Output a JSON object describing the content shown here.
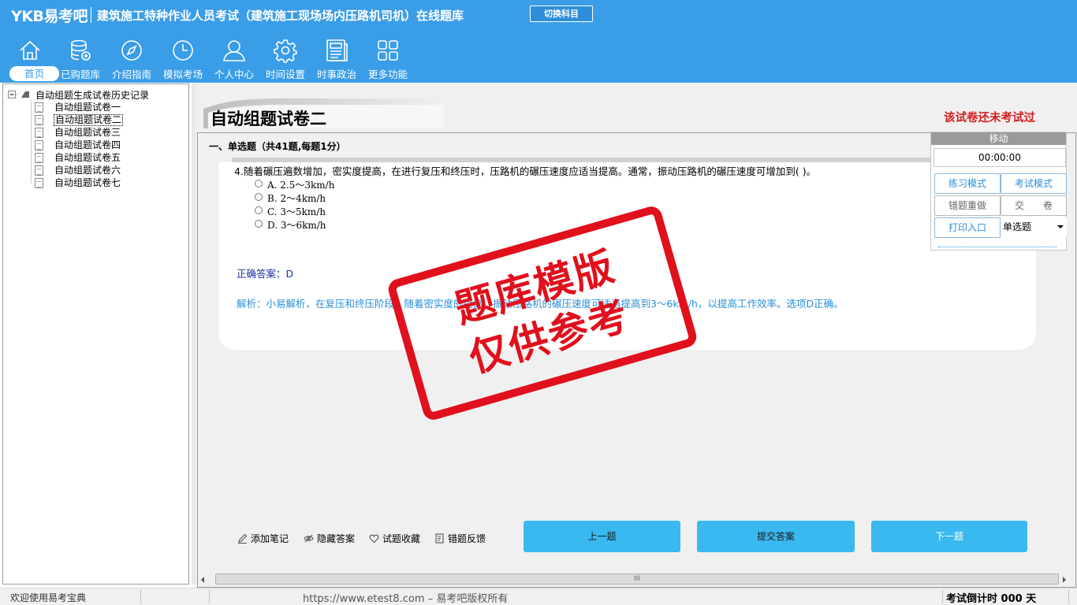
{
  "header": {
    "logo": "YKB易考吧",
    "title": "建筑施工特种作业人员考试（建筑施工现场场内压路机司机）在线题库",
    "switch_subject": "切换科目"
  },
  "nav": [
    {
      "label": "首页",
      "icon": "home-icon"
    },
    {
      "label": "已购题库",
      "icon": "database-icon"
    },
    {
      "label": "介绍指南",
      "icon": "compass-icon"
    },
    {
      "label": "模拟考场",
      "icon": "clock-icon"
    },
    {
      "label": "个人中心",
      "icon": "user-icon"
    },
    {
      "label": "时间设置",
      "icon": "gear-icon"
    },
    {
      "label": "时事政治",
      "icon": "newspaper-icon"
    },
    {
      "label": "更多功能",
      "icon": "grid-icon"
    }
  ],
  "tree": {
    "root": "自动组题生成试卷历史记录",
    "items": [
      "自动组题试卷一",
      "自动组题试卷二",
      "自动组题试卷三",
      "自动组题试卷四",
      "自动组题试卷五",
      "自动组题试卷六",
      "自动组题试卷七"
    ],
    "selected_index": 1
  },
  "paper": {
    "title": "自动组题试卷二",
    "status": "该试卷还未考试过",
    "section": "一、单选题（共41题,每题1分）"
  },
  "question": {
    "text": "4.随着碾压遍数增加，密实度提高，在进行复压和终压时，压路机的碾压速度应适当提高。通常，振动压路机的碾压速度可增加到(  )。",
    "options": [
      "A. 2.5～3km/h",
      "B. 2～4km/h",
      "C. 3～5km/h",
      "D. 3～6km/h"
    ],
    "answer": "正确答案：D",
    "analysis": "解析：小易解析，在复压和终压阶段，随着密实度的提高，振动压路机的碾压速度可适当提高到3～6km/h，以提高工作效率。选项D正确。"
  },
  "stamp": {
    "line1": "题库模版",
    "line2": "仅供参考"
  },
  "float_panel": {
    "move": "移动",
    "timer": "00:00:00",
    "practice_mode": "练习模式",
    "exam_mode": "考试模式",
    "redo_wrong": "错题重做",
    "submit_paper": "交　　卷",
    "print_entry": "打印入口",
    "question_type": "单选题"
  },
  "tools": {
    "add_note": "添加笔记",
    "hide_answer": "隐藏答案",
    "favorite": "试题收藏",
    "feedback": "错题反馈"
  },
  "buttons": {
    "prev": "上一题",
    "submit": "提交答案",
    "next": "下一题"
  },
  "scrollbar": {
    "thumb_grip": "III"
  },
  "statusbar": {
    "welcome": "欢迎使用易考宝典",
    "url": "https://www.etest8.com – 易考吧版权所有",
    "countdown": "考试倒计时 000 天"
  }
}
